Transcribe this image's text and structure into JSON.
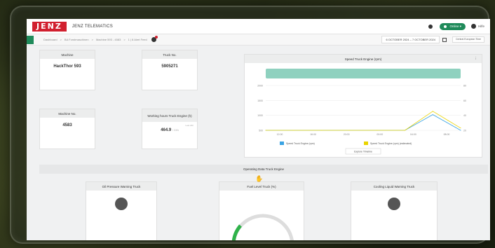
{
  "app": {
    "logo": "JENZ",
    "title": "JENZ TELEMATICS"
  },
  "header": {
    "status_label": "Online ▾",
    "user_label": "Hilfe"
  },
  "subbar": {
    "breadcrumb": [
      "Dashboard",
      ">",
      "BA Forstmaschinen",
      ">",
      "Machine 593 - 4583",
      ">",
      "1 | 8 Alert Feed"
    ],
    "date_range": "6 OCTOBER 2024 – 7 OCTOBER 2024",
    "timezone": "Central European Time"
  },
  "cards": {
    "machine": {
      "label": "Machine",
      "value": "HackThor 593"
    },
    "truck": {
      "label": "Truck No.",
      "value": "5905271"
    },
    "machine_no": {
      "label": "Machine No.",
      "value": "4583"
    },
    "working_hours": {
      "label": "Working hours Truck Engine (h)",
      "value": "464.9",
      "unit": "/ 24h",
      "sub": "Last 24h"
    }
  },
  "chart": {
    "title": "Speed Truck Engine (rpm)",
    "close_label": "⋮",
    "yticks_left": [
      "2000",
      "1500",
      "1000",
      "500"
    ],
    "yticks_right": [
      "80",
      "60",
      "40",
      "20"
    ],
    "xticks": [
      "12:00",
      "16:00",
      "20:00",
      "00:00",
      "04:00",
      "08:00"
    ],
    "legend": [
      {
        "name": "Speed Truck Engine (rpm)",
        "color": "#3aa3e3"
      },
      {
        "name": "Speed Truck Engine (rpm) (estimated)",
        "color": "#e9d400"
      }
    ],
    "button": "Explore Timeline",
    "band_color": "#8fd1bf",
    "chart_data": {
      "type": "line",
      "x": [
        "12:00",
        "16:00",
        "20:00",
        "00:00",
        "04:00",
        "08:00",
        "09:00",
        "10:00"
      ],
      "series": [
        {
          "name": "Speed Truck Engine (rpm)",
          "values": [
            0,
            0,
            0,
            0,
            0,
            0,
            700,
            0
          ]
        },
        {
          "name": "Speed Truck Engine (rpm) (estimated)",
          "values": [
            0,
            0,
            0,
            0,
            0,
            0,
            850,
            100
          ]
        }
      ],
      "ylim": [
        0,
        2000
      ]
    }
  },
  "section": {
    "title": "Operating Data Truck Engine"
  },
  "bottom_cards": [
    {
      "label": "Oil Pressure Warning Truck"
    },
    {
      "label": "Fuel Level Truck (%)"
    },
    {
      "label": "Cooling Liquid Warning Truck"
    }
  ]
}
